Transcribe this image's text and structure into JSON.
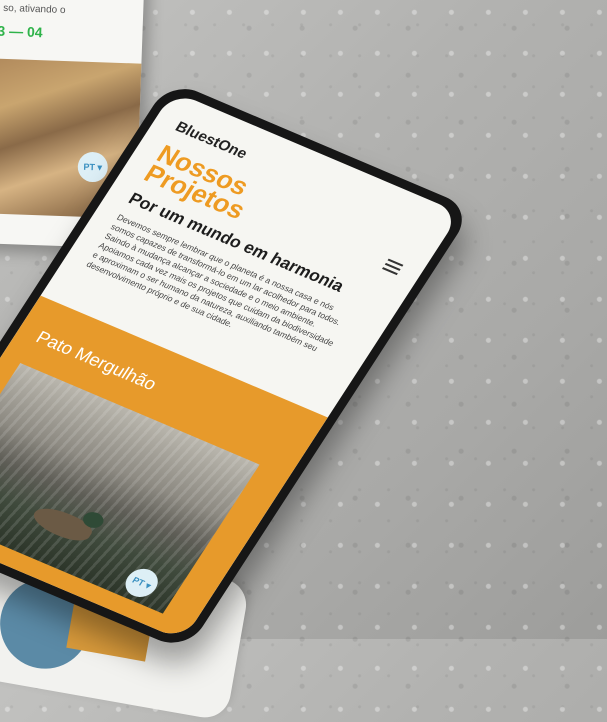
{
  "back_device": {
    "snippet": "so, ativando o",
    "counter": "3 — 04",
    "language": "PT ▾"
  },
  "device": {
    "brand": "BluestOne",
    "title": "Nossos Projetos",
    "subtitle": "Por um mundo em harmonia",
    "body": "Devemos sempre lembrar que o planeta é a nossa casa e nós somos capazes de transformá-lo em um lar acolhedor para todos. Saindo à mudança alcançar a sociedade e o meio ambiente. Apoiamos cada vez mais os projetos que cuidam da biodiversidade e aproximam o ser humano da natureza, auxiliando também seu desenvolvimento próprio e de sua cidade.",
    "card": {
      "title": "Pato Mergulhão",
      "language": "PT ▾"
    }
  },
  "colors": {
    "accent_orange": "#ee9b22",
    "card_orange": "#e79a2b",
    "counter_green": "#2fb34a"
  },
  "icons": [
    "hamburger-menu-icon"
  ]
}
